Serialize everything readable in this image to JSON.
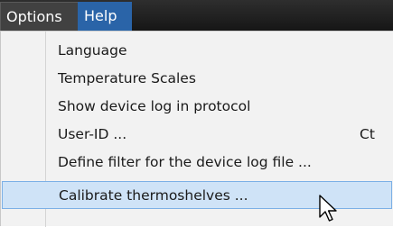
{
  "menubar": {
    "options_label": "Options",
    "help_label": "Help"
  },
  "menu": {
    "items": [
      {
        "label": "Language",
        "shortcut": ""
      },
      {
        "label": "Temperature Scales",
        "shortcut": ""
      },
      {
        "label": "Show device log in protocol",
        "shortcut": ""
      },
      {
        "label": "User-ID ...",
        "shortcut": "Ct"
      },
      {
        "label": "Define filter for the device log file ...",
        "shortcut": ""
      },
      {
        "label": "Calibrate thermoshelves ...",
        "shortcut": ""
      }
    ],
    "highlighted_index": 5
  },
  "colors": {
    "menubar_bg": "#1e1e1e",
    "help_active": "#2a64a8",
    "menu_bg": "#f2f2f2",
    "highlight_bg": "#cfe3f7",
    "highlight_border": "#7cb0e6"
  },
  "icons": {
    "cursor": "mouse-pointer-icon"
  }
}
